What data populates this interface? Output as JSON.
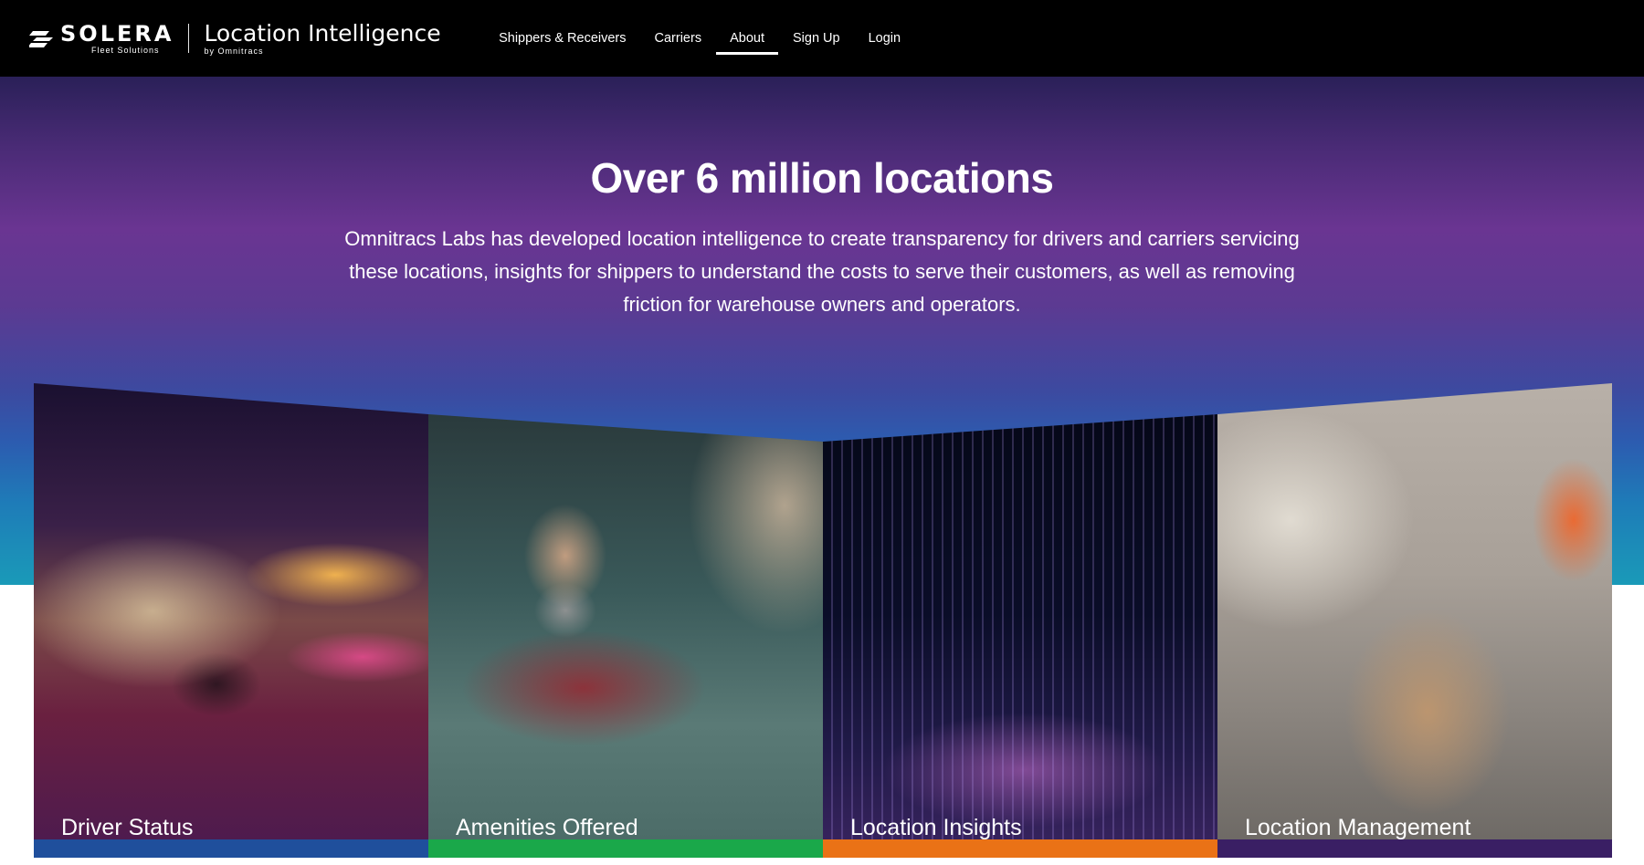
{
  "header": {
    "brand": "SOLERA",
    "brand_sub": "Fleet Solutions",
    "product": "Location Intelligence",
    "product_sub": "by Omnitracs",
    "nav": [
      {
        "label": "Shippers & Receivers",
        "active": false
      },
      {
        "label": "Carriers",
        "active": false
      },
      {
        "label": "About",
        "active": true
      },
      {
        "label": "Sign Up",
        "active": false
      },
      {
        "label": "Login",
        "active": false
      }
    ]
  },
  "hero": {
    "title": "Over 6 million locations",
    "description": "Omnitracs Labs has developed location intelligence to create transparency for drivers and carriers servicing these locations, insights for shippers to understand the costs to serve their customers, as well as removing friction for warehouse owners and operators."
  },
  "cards": [
    {
      "label": "Driver Status",
      "bar_color": "#1f4f9c"
    },
    {
      "label": "Amenities Offered",
      "bar_color": "#1aa84a"
    },
    {
      "label": "Location Insights",
      "bar_color": "#ea7216"
    },
    {
      "label": "Location Management",
      "bar_color": "#3a1f64"
    }
  ],
  "colors": {
    "header_bg": "#000000",
    "hero_top": "#4a2b76",
    "hero_bottom": "#1a9ab8"
  }
}
